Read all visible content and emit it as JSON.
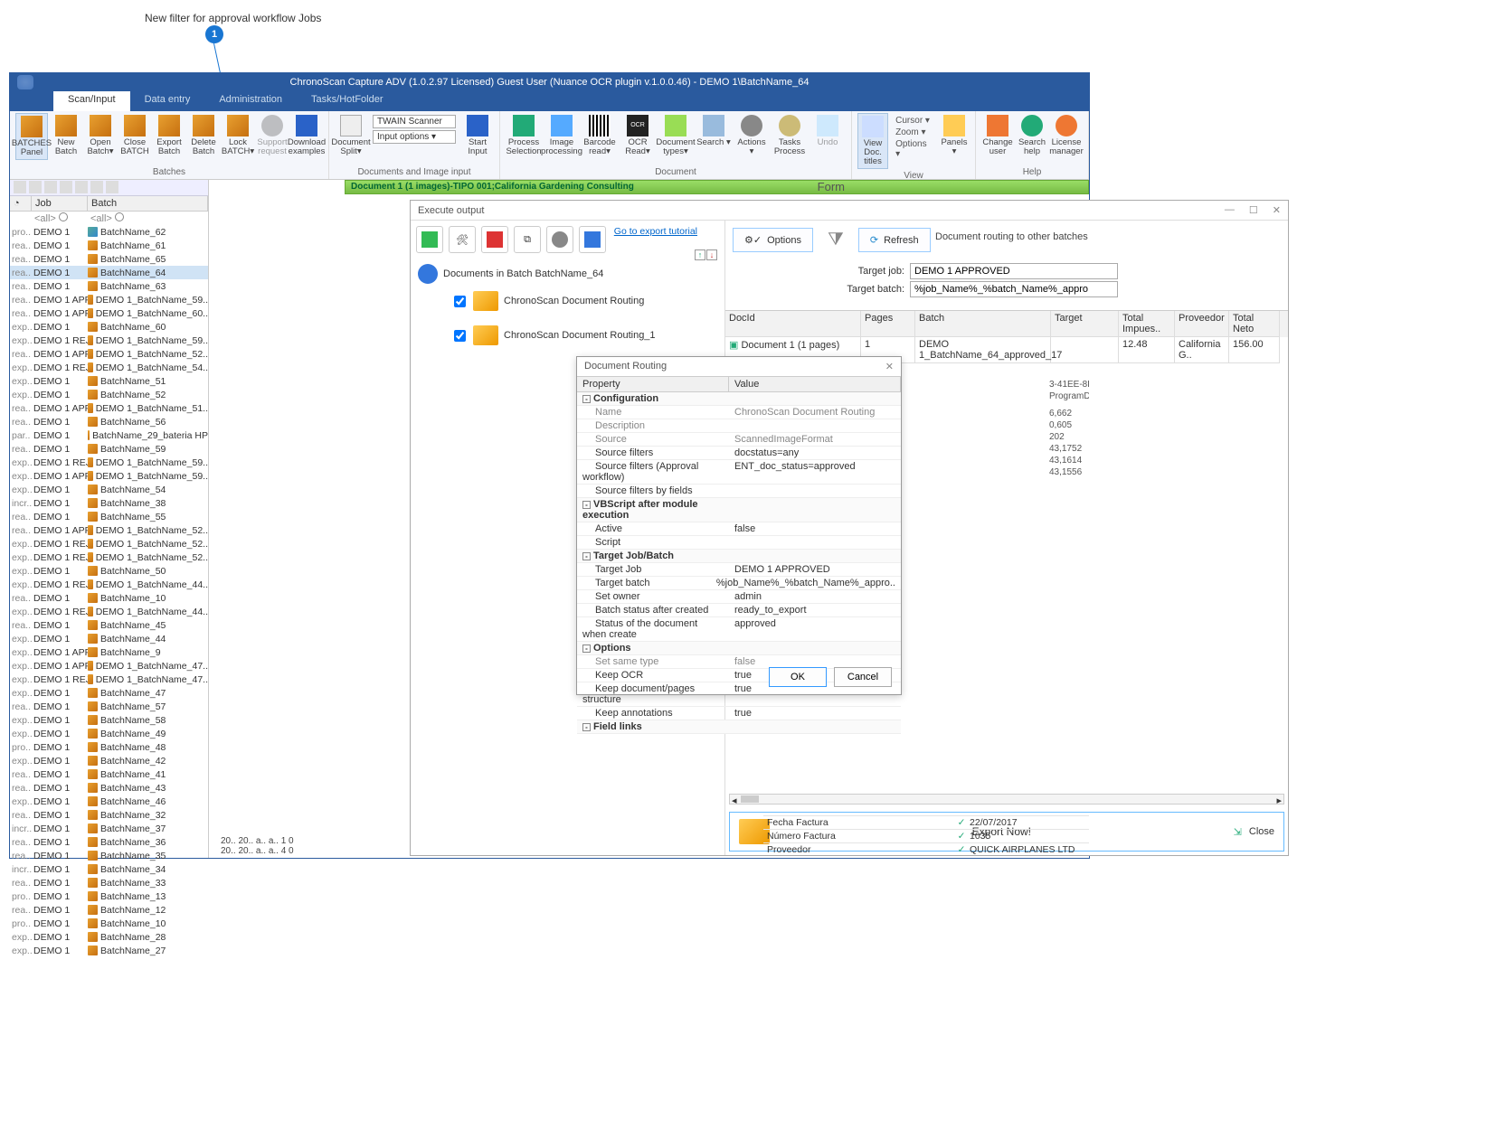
{
  "annotation": {
    "text": "New filter for approval workflow Jobs",
    "badge": "1"
  },
  "titlebar": "ChronoScan Capture ADV (1.0.2.97 Licensed) Guest User  (Nuance OCR plugin v.1.0.0.46)  - DEMO 1\\BatchName_64",
  "tabs": [
    "Scan/Input",
    "Data entry",
    "Administration",
    "Tasks/HotFolder"
  ],
  "ribbon": {
    "batches": {
      "label": "Batches",
      "btns": [
        "BATCHES Panel",
        "New Batch",
        "Open Batch▾",
        "Close BATCH",
        "Export Batch",
        "Delete Batch",
        "Lock BATCH▾",
        "Support request",
        "Download examples"
      ]
    },
    "doc_input": {
      "label": "Documents and Image input",
      "btns": [
        "Document Split▾",
        "Start Input"
      ],
      "scanner": "TWAIN Scanner",
      "inputopt": "Input options ▾"
    },
    "document": {
      "label": "Document",
      "btns": [
        "Process Selection",
        "Image processing",
        "Barcode read▾",
        "OCR Read▾",
        "Document types▾",
        "Search ▾",
        "Actions ▾",
        "Tasks Process",
        "Undo"
      ]
    },
    "view": {
      "label": "View",
      "btns": [
        "View Doc. titles",
        "Panels ▾"
      ],
      "items": [
        "Cursor ▾",
        "Zoom ▾",
        "Options ▾"
      ]
    },
    "help": {
      "label": "Help",
      "btns": [
        "Change user",
        "Search help",
        "License manager"
      ]
    }
  },
  "left_panel": {
    "headers": [
      "",
      "Job",
      "Batch"
    ],
    "filter": "<all>",
    "rows": [
      {
        "s": "pro..",
        "j": "DEMO 1",
        "b": "BatchName_62",
        "ico": "blue"
      },
      {
        "s": "rea..",
        "j": "DEMO 1",
        "b": "BatchName_61"
      },
      {
        "s": "rea..",
        "j": "DEMO 1",
        "b": "BatchName_65"
      },
      {
        "s": "rea..",
        "j": "DEMO 1",
        "b": "BatchName_64",
        "sel": true
      },
      {
        "s": "rea..",
        "j": "DEMO 1",
        "b": "BatchName_63"
      },
      {
        "s": "rea..",
        "j": "DEMO 1 APP..",
        "b": "DEMO 1_BatchName_59.."
      },
      {
        "s": "rea..",
        "j": "DEMO 1 APP..",
        "b": "DEMO 1_BatchName_60.."
      },
      {
        "s": "exp..",
        "j": "DEMO 1",
        "b": "BatchName_60"
      },
      {
        "s": "exp..",
        "j": "DEMO 1 REJ..",
        "b": "DEMO 1_BatchName_59.."
      },
      {
        "s": "rea..",
        "j": "DEMO 1 APP..",
        "b": "DEMO 1_BatchName_52.."
      },
      {
        "s": "exp..",
        "j": "DEMO 1 REJ..",
        "b": "DEMO 1_BatchName_54.."
      },
      {
        "s": "exp..",
        "j": "DEMO 1",
        "b": "BatchName_51"
      },
      {
        "s": "exp..",
        "j": "DEMO 1",
        "b": "BatchName_52"
      },
      {
        "s": "rea..",
        "j": "DEMO 1 APP..",
        "b": "DEMO 1_BatchName_51.."
      },
      {
        "s": "rea..",
        "j": "DEMO 1",
        "b": "BatchName_56"
      },
      {
        "s": "par..",
        "j": "DEMO 1",
        "b": "BatchName_29_bateria HP"
      },
      {
        "s": "rea..",
        "j": "DEMO 1",
        "b": "BatchName_59"
      },
      {
        "s": "exp..",
        "j": "DEMO 1 REJ..",
        "b": "DEMO 1_BatchName_59.."
      },
      {
        "s": "exp..",
        "j": "DEMO 1 APP..",
        "b": "DEMO 1_BatchName_59.."
      },
      {
        "s": "exp..",
        "j": "DEMO 1",
        "b": "BatchName_54"
      },
      {
        "s": "incr..",
        "j": "DEMO 1",
        "b": "BatchName_38"
      },
      {
        "s": "rea..",
        "j": "DEMO 1",
        "b": "BatchName_55"
      },
      {
        "s": "rea..",
        "j": "DEMO 1 APP..",
        "b": "DEMO 1_BatchName_52.."
      },
      {
        "s": "exp..",
        "j": "DEMO 1 REJ..",
        "b": "DEMO 1_BatchName_52.."
      },
      {
        "s": "exp..",
        "j": "DEMO 1 REJ..",
        "b": "DEMO 1_BatchName_52.."
      },
      {
        "s": "exp..",
        "j": "DEMO 1",
        "b": "BatchName_50"
      },
      {
        "s": "exp..",
        "j": "DEMO 1 REJ..",
        "b": "DEMO 1_BatchName_44.."
      },
      {
        "s": "rea..",
        "j": "DEMO 1",
        "b": "BatchName_10"
      },
      {
        "s": "exp..",
        "j": "DEMO 1 REJ..",
        "b": "DEMO 1_BatchName_44.."
      },
      {
        "s": "rea..",
        "j": "DEMO 1",
        "b": "BatchName_45"
      },
      {
        "s": "exp..",
        "j": "DEMO 1",
        "b": "BatchName_44"
      },
      {
        "s": "exp..",
        "j": "DEMO 1 APP..",
        "b": "BatchName_9"
      },
      {
        "s": "exp..",
        "j": "DEMO 1 APP..",
        "b": "DEMO 1_BatchName_47.."
      },
      {
        "s": "exp..",
        "j": "DEMO 1 REJ..",
        "b": "DEMO 1_BatchName_47.."
      },
      {
        "s": "exp..",
        "j": "DEMO 1",
        "b": "BatchName_47",
        "ico": "red"
      },
      {
        "s": "rea..",
        "j": "DEMO 1",
        "b": "BatchName_57"
      },
      {
        "s": "exp..",
        "j": "DEMO 1",
        "b": "BatchName_58",
        "ico": "red"
      },
      {
        "s": "exp..",
        "j": "DEMO 1",
        "b": "BatchName_49"
      },
      {
        "s": "pro..",
        "j": "DEMO 1",
        "b": "BatchName_48"
      },
      {
        "s": "exp..",
        "j": "DEMO 1",
        "b": "BatchName_42"
      },
      {
        "s": "rea..",
        "j": "DEMO 1",
        "b": "BatchName_41"
      },
      {
        "s": "rea..",
        "j": "DEMO 1",
        "b": "BatchName_43"
      },
      {
        "s": "exp..",
        "j": "DEMO 1",
        "b": "BatchName_46"
      },
      {
        "s": "rea..",
        "j": "DEMO 1",
        "b": "BatchName_32"
      },
      {
        "s": "incr..",
        "j": "DEMO 1",
        "b": "BatchName_37"
      },
      {
        "s": "rea..",
        "j": "DEMO 1",
        "b": "BatchName_36"
      },
      {
        "s": "rea..",
        "j": "DEMO 1",
        "b": "BatchName_35"
      },
      {
        "s": "incr..",
        "j": "DEMO 1",
        "b": "BatchName_34"
      },
      {
        "s": "rea..",
        "j": "DEMO 1",
        "b": "BatchName_33"
      },
      {
        "s": "pro..",
        "j": "DEMO 1",
        "b": "BatchName_13",
        "ico": "red"
      },
      {
        "s": "rea..",
        "j": "DEMO 1",
        "b": "BatchName_12"
      },
      {
        "s": "pro..",
        "j": "DEMO 1",
        "b": "BatchName_10"
      },
      {
        "s": "exp..",
        "j": "DEMO 1",
        "b": "BatchName_28"
      },
      {
        "s": "exp..",
        "j": "DEMO 1",
        "b": "BatchName_27"
      }
    ]
  },
  "docbar": "Document 1 (1 images)-TIPO 001;California Gardening Consulting",
  "form_label": "Form",
  "exec": {
    "title": "Execute output",
    "link": "Go to export tutorial",
    "tree_root": "Documents in Batch BatchName_64",
    "tree_nodes": [
      "ChronoScan Document Routing",
      "ChronoScan Document Routing_1"
    ],
    "btns": {
      "options": "Options",
      "refresh": "Refresh"
    },
    "heading": "Document routing to other batches",
    "fields": {
      "target_job_label": "Target job:",
      "target_job": "DEMO 1 APPROVED",
      "target_batch_label": "Target batch:",
      "target_batch": "%job_Name%_%batch_Name%_appro"
    },
    "grid": {
      "headers": [
        "DocId",
        "Pages",
        "Batch",
        "Target",
        "Total Impues..",
        "Proveedor",
        "Total Neto"
      ],
      "row": [
        "Document 1 (1 pages)",
        "1",
        "DEMO 1_BatchName_64_approved_17",
        "",
        "12.48",
        "California G..",
        "156.00"
      ]
    },
    "export_now": "Export Now!",
    "close": "Close"
  },
  "dr": {
    "title": "Document Routing",
    "headers": [
      "Property",
      "Value"
    ],
    "rows": [
      {
        "g": true,
        "k": "Configuration",
        "v": ""
      },
      {
        "dim": true,
        "k": "Name",
        "v": "ChronoScan Document Routing"
      },
      {
        "dim": true,
        "k": "Description",
        "v": ""
      },
      {
        "dim": true,
        "k": "Source",
        "v": "ScannedImageFormat"
      },
      {
        "k": "Source filters",
        "v": "docstatus=any"
      },
      {
        "k": "Source filters (Approval workflow)",
        "v": "ENT_doc_status=approved"
      },
      {
        "k": "Source filters by fields",
        "v": ""
      },
      {
        "g": true,
        "k": "VBScript after module execution",
        "v": ""
      },
      {
        "k": "Active",
        "v": "false"
      },
      {
        "k": "Script",
        "v": ""
      },
      {
        "g": true,
        "k": "Target Job/Batch",
        "v": ""
      },
      {
        "k": "Target Job",
        "v": "DEMO 1 APPROVED"
      },
      {
        "k": "Target batch",
        "v": "%job_Name%_%batch_Name%_appro.."
      },
      {
        "k": "Set owner",
        "v": "admin"
      },
      {
        "k": "Batch status after created",
        "v": "ready_to_export"
      },
      {
        "k": "Status of the document when create",
        "v": "approved"
      },
      {
        "g": true,
        "k": "Options",
        "v": ""
      },
      {
        "dim": true,
        "k": "Set same type",
        "v": "false"
      },
      {
        "k": "Keep OCR",
        "v": "true"
      },
      {
        "k": "Keep document/pages structure",
        "v": "true"
      },
      {
        "k": "Keep annotations",
        "v": "true"
      },
      {
        "g": true,
        "k": "Field links",
        "v": ""
      }
    ],
    "ok": "OK",
    "cancel": "Cancel"
  },
  "right_strip": [
    "3-41EE-8D",
    "ProgramDa",
    "",
    "",
    "",
    "6,662",
    "0,605",
    "202",
    "43,1752",
    "43,1614",
    "43,1556"
  ],
  "bottom_strip": [
    "20..  20..  a.. a..  1   0",
    "20..  20..  a.. a..  4   0"
  ],
  "form_bottom": [
    {
      "lbl": "Fecha Factura",
      "val": "22/07/2017"
    },
    {
      "lbl": "Número Factura",
      "val": "1035"
    },
    {
      "lbl": "Proveedor",
      "val": "QUICK AIRPLANES LTD"
    }
  ]
}
